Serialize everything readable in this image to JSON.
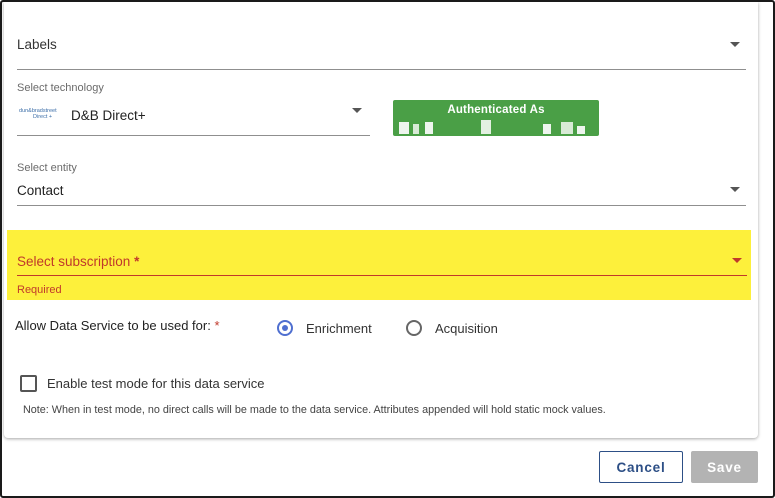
{
  "labels_field": {
    "label": "Labels"
  },
  "technology_field": {
    "label": "Select technology",
    "value": "D&B Direct+",
    "logo_text_line1": "dun&bradstreet",
    "logo_text_line2": "Direct +"
  },
  "auth_status": {
    "title": "Authenticated As"
  },
  "entity_field": {
    "label": "Select entity",
    "value": "Contact"
  },
  "subscription_field": {
    "label": "Select subscription",
    "required_marker": "*",
    "error": "Required"
  },
  "usage": {
    "label": "Allow Data Service to be used for:",
    "required_marker": "*",
    "options": [
      {
        "label": "Enrichment",
        "selected": true
      },
      {
        "label": "Acquisition",
        "selected": false
      }
    ]
  },
  "test_mode": {
    "label": "Enable test mode for this data service",
    "checked": false,
    "note": "Note: When in test mode, no direct calls will be made to the data service. Attributes appended will hold static mock values."
  },
  "buttons": {
    "cancel": "Cancel",
    "save": "Save"
  },
  "colors": {
    "highlight": "#fdf03b",
    "error": "#c0392b",
    "auth_green": "#4a9f46",
    "radio_accent": "#4f6fd0",
    "cancel_border": "#2d4f86",
    "save_disabled": "#b3b3b3"
  }
}
